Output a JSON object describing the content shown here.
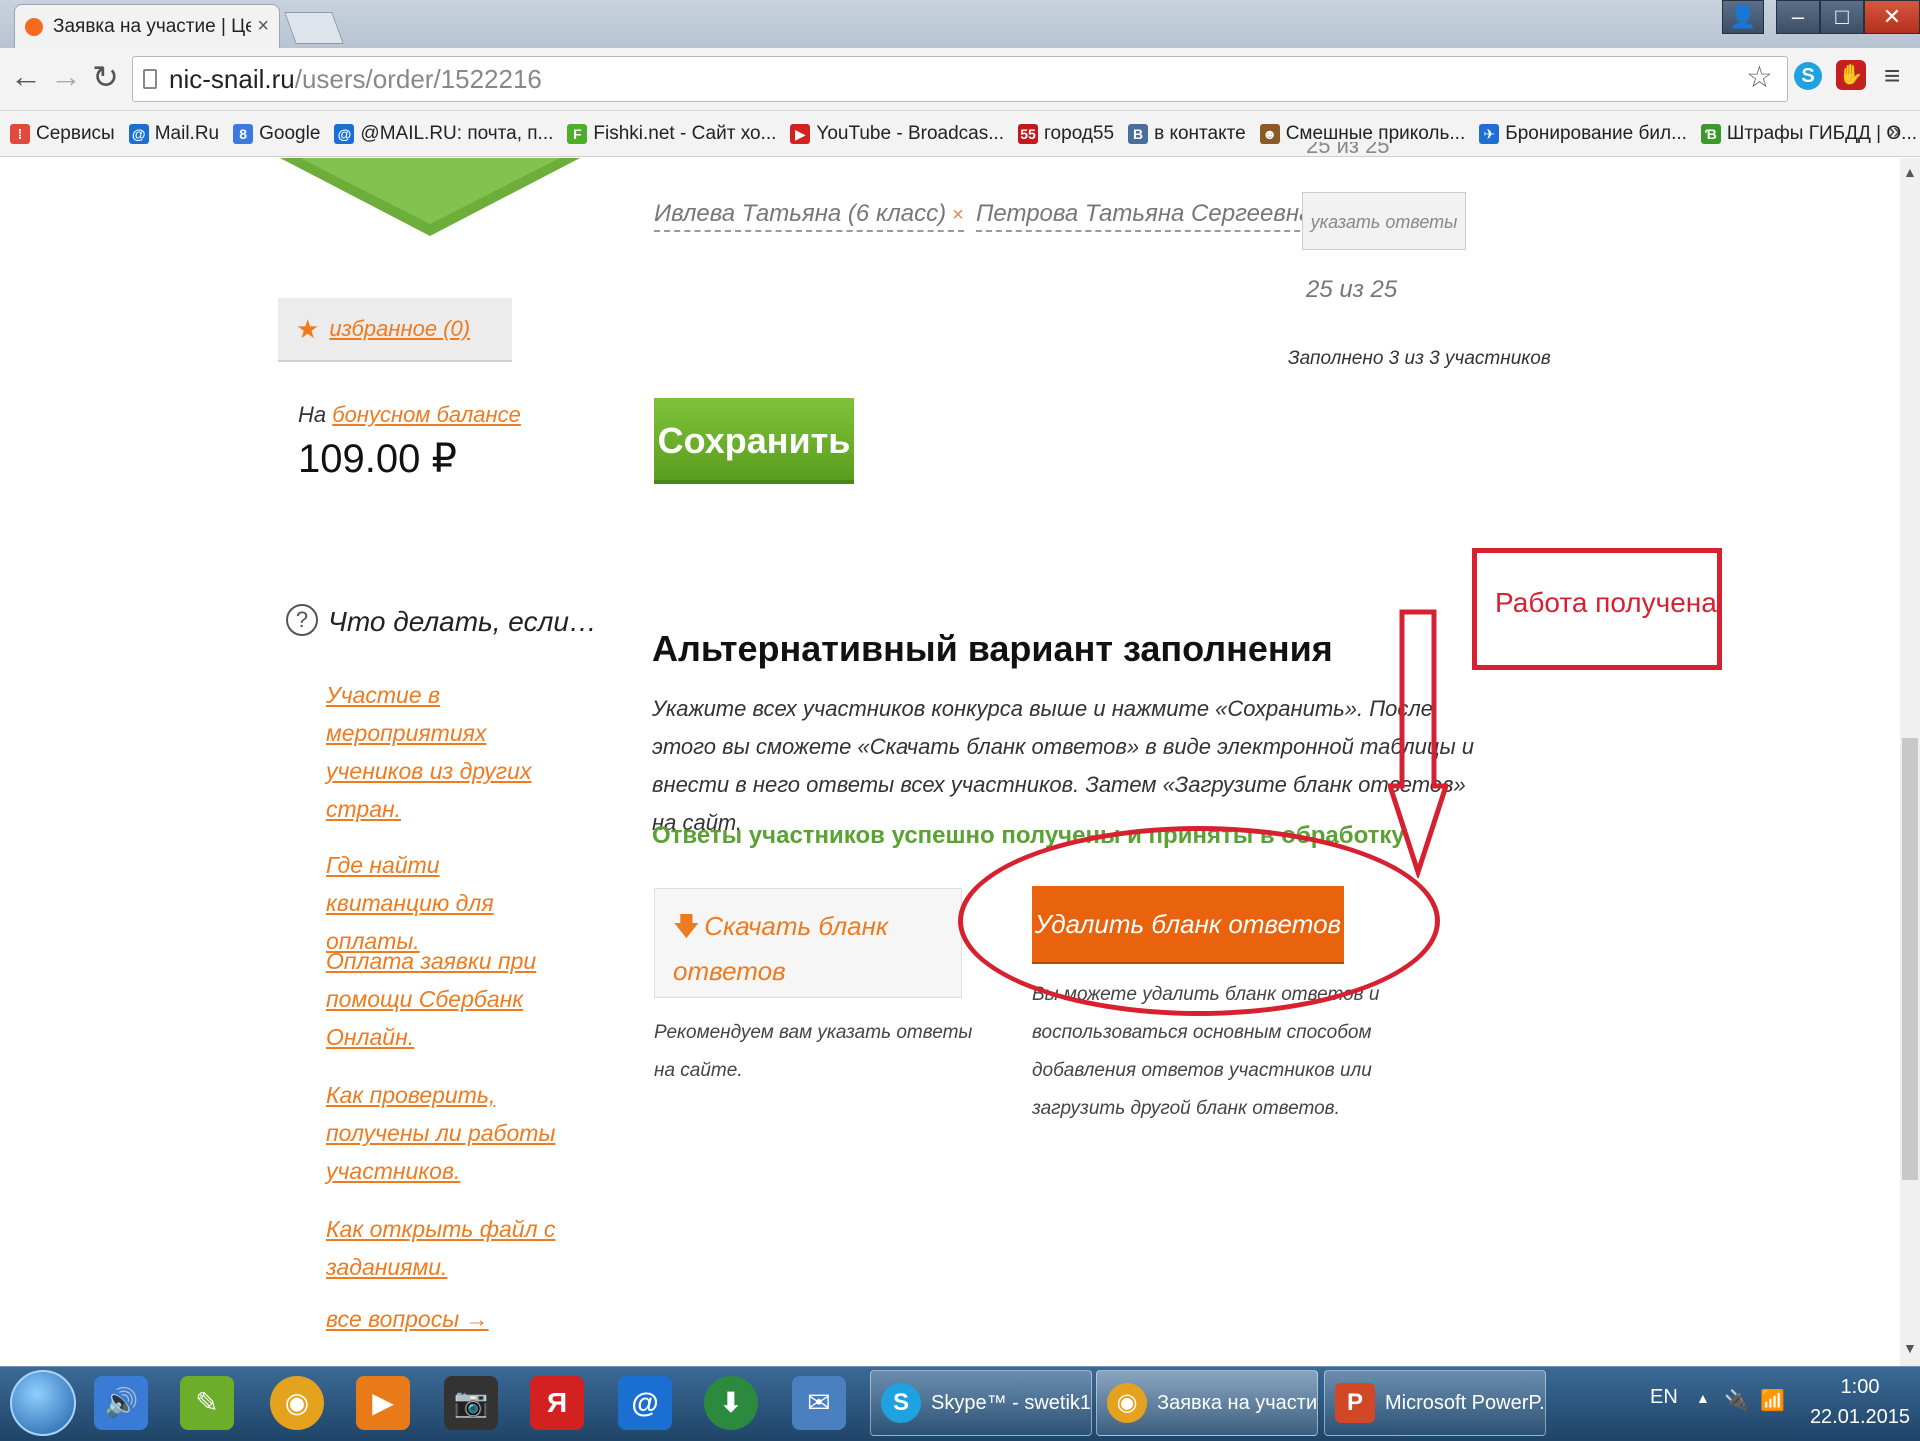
{
  "browser": {
    "tab_title": "Заявка на участие | Цент",
    "tab_close": "×",
    "url_host": "nic-snail.ru",
    "url_path": "/users/order/1522216",
    "bookmarks": [
      {
        "label": "Сервисы",
        "icon": "apps-icon",
        "color": "#e04a3c",
        "glyph": "⁞"
      },
      {
        "label": "Mail.Ru",
        "icon": "mailru-icon",
        "color": "#1a6fd0",
        "glyph": "@"
      },
      {
        "label": "Google",
        "icon": "google-icon",
        "color": "#3b7be0",
        "glyph": "8"
      },
      {
        "label": "@MAIL.RU: почта, п...",
        "icon": "mailru-icon",
        "color": "#1a6fd0",
        "glyph": "@"
      },
      {
        "label": "Fishki.net - Сайт хо...",
        "icon": "fishki-icon",
        "color": "#4caf2a",
        "glyph": "F"
      },
      {
        "label": "YouTube - Broadcas...",
        "icon": "youtube-icon",
        "color": "#d32020",
        "glyph": "▶"
      },
      {
        "label": "город55",
        "icon": "gorod55-icon",
        "color": "#c21a1a",
        "glyph": "55"
      },
      {
        "label": "в контакте",
        "icon": "vk-icon",
        "color": "#4a6e9c",
        "glyph": "B"
      },
      {
        "label": "Смешные приколь...",
        "icon": "funny-icon",
        "color": "#8b5a2b",
        "glyph": "☻"
      },
      {
        "label": "Бронирование бил...",
        "icon": "booking-icon",
        "color": "#1f6fd0",
        "glyph": "✈"
      },
      {
        "label": "Штрафы ГИБДД | О...",
        "icon": "gibdd-icon",
        "color": "#3c9a2a",
        "glyph": "Ɓ"
      }
    ],
    "bookmarks_more": "»"
  },
  "page": {
    "participants": [
      {
        "name": "Ивлева Татьяна (6 класс)",
        "remove": "×"
      },
      {
        "name": "Петрова Татьяна Сергеевна",
        "remove": "×"
      }
    ],
    "cut_text": "25 из 25",
    "answers_button": "указать ответы",
    "count": "25 из 25",
    "filled": "Заполнено 3 из 3 участников",
    "favorites": "избранное (0)",
    "save_button": "Сохранить",
    "bonus_prefix": "На",
    "bonus_link": "бонусном балансе",
    "bonus_amount": "109.00 ₽",
    "help_title": "Что делать, если…",
    "help_links": [
      "Участие в мероприятиях учеников из других стран.",
      "Где найти квитанцию для оплаты.",
      "Оплата заявки при помощи Сбербанк Онлайн.",
      "Как проверить, получены ли работы участников.",
      "Как открыть файл с заданиями."
    ],
    "help_all": "все вопросы →",
    "alt_heading": "Альтернативный вариант заполнения",
    "alt_text": "Укажите всех участников конкурса выше и нажмите «Сохранить». После этого вы сможете «Скачать бланк ответов» в виде электронной таблицы и внести в него ответы всех участников. Затем «Загрузите бланк ответов» на сайт.",
    "success": "Ответы участников успешно получены и приняты в обработку",
    "download_button": "Скачать бланк ответов",
    "recommend": "Рекомендуем вам указать ответы на сайте.",
    "delete_button": "Удалить бланк ответов",
    "delete_note": "Вы можете удалить бланк ответов и воспользоваться основным способом добавления ответов участников или загрузить другой бланк ответов."
  },
  "annotation": {
    "label": "Работа получена",
    "color": "#d72030"
  },
  "taskbar": {
    "tasks": [
      {
        "label": "Skype™ - swetik1...",
        "icon": "skype-icon"
      },
      {
        "label": "Заявка на участи...",
        "icon": "chrome-icon"
      },
      {
        "label": "Microsoft PowerP...",
        "icon": "powerpoint-icon"
      }
    ],
    "lang": "EN",
    "time": "1:00",
    "date": "22.01.2015"
  }
}
